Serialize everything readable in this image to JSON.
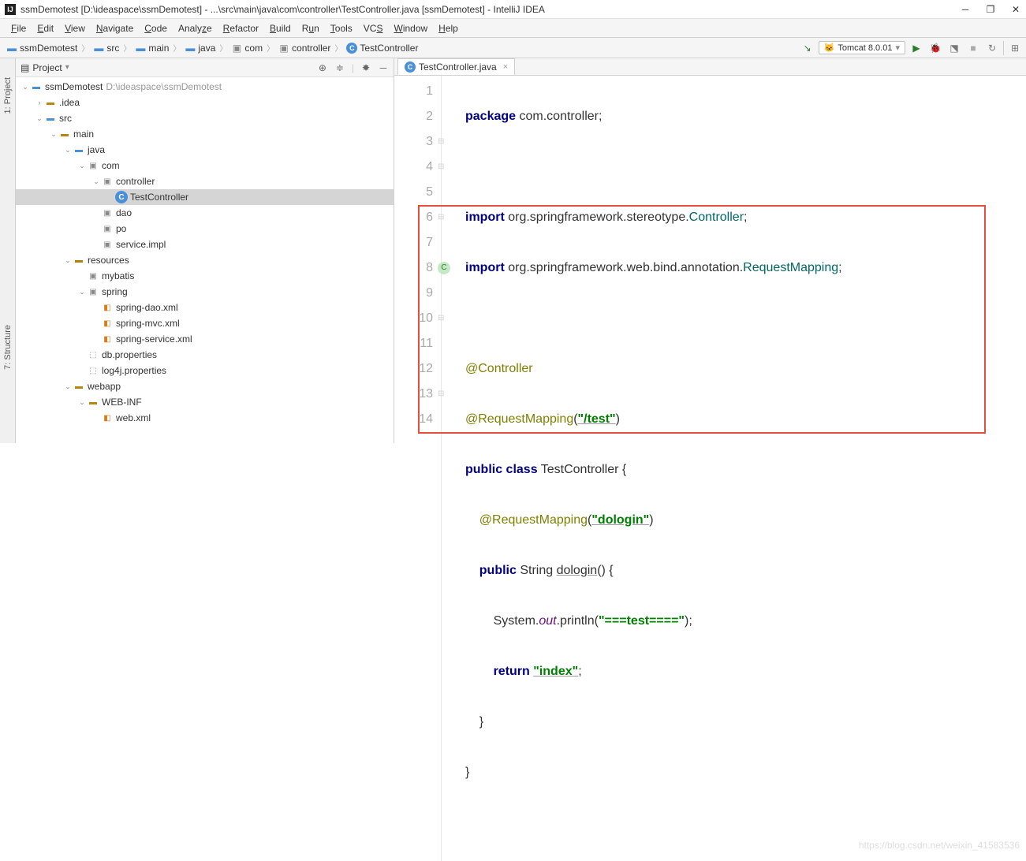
{
  "window": {
    "title": "ssmDemotest [D:\\ideaspace\\ssmDemotest] - ...\\src\\main\\java\\com\\controller\\TestController.java [ssmDemotest] - IntelliJ IDEA"
  },
  "menu": [
    "File",
    "Edit",
    "View",
    "Navigate",
    "Code",
    "Analyze",
    "Refactor",
    "Build",
    "Run",
    "Tools",
    "VCS",
    "Window",
    "Help"
  ],
  "breadcrumb": [
    {
      "label": "ssmDemotest",
      "icon": "folder-blue"
    },
    {
      "label": "src",
      "icon": "folder-blue"
    },
    {
      "label": "main",
      "icon": "folder-blue"
    },
    {
      "label": "java",
      "icon": "folder-blue"
    },
    {
      "label": "com",
      "icon": "pkg"
    },
    {
      "label": "controller",
      "icon": "pkg"
    },
    {
      "label": "TestController",
      "icon": "class"
    }
  ],
  "runconfig": "Tomcat 8.0.01",
  "sidepanels": {
    "project": "1: Project",
    "structure": "7: Structure"
  },
  "projectpanel": {
    "title": "Project"
  },
  "tree": [
    {
      "depth": 0,
      "arrow": "v",
      "icon": "folder-blue",
      "label": "ssmDemotest",
      "path": "D:\\ideaspace\\ssmDemotest"
    },
    {
      "depth": 1,
      "arrow": ">",
      "icon": "folder",
      "label": ".idea"
    },
    {
      "depth": 1,
      "arrow": "v",
      "icon": "folder-blue",
      "label": "src"
    },
    {
      "depth": 2,
      "arrow": "v",
      "icon": "folder",
      "label": "main"
    },
    {
      "depth": 3,
      "arrow": "v",
      "icon": "folder-blue",
      "label": "java"
    },
    {
      "depth": 4,
      "arrow": "v",
      "icon": "pkg",
      "label": "com"
    },
    {
      "depth": 5,
      "arrow": "v",
      "icon": "pkg",
      "label": "controller"
    },
    {
      "depth": 6,
      "arrow": "",
      "icon": "class",
      "label": "TestController",
      "sel": true
    },
    {
      "depth": 5,
      "arrow": "",
      "icon": "pkg",
      "label": "dao"
    },
    {
      "depth": 5,
      "arrow": "",
      "icon": "pkg",
      "label": "po"
    },
    {
      "depth": 5,
      "arrow": "",
      "icon": "pkg",
      "label": "service.impl"
    },
    {
      "depth": 3,
      "arrow": "v",
      "icon": "folder-res",
      "label": "resources"
    },
    {
      "depth": 4,
      "arrow": "",
      "icon": "pkg",
      "label": "mybatis"
    },
    {
      "depth": 4,
      "arrow": "v",
      "icon": "pkg",
      "label": "spring"
    },
    {
      "depth": 5,
      "arrow": "",
      "icon": "xml",
      "label": "spring-dao.xml"
    },
    {
      "depth": 5,
      "arrow": "",
      "icon": "xml",
      "label": "spring-mvc.xml"
    },
    {
      "depth": 5,
      "arrow": "",
      "icon": "xml",
      "label": "spring-service.xml"
    },
    {
      "depth": 4,
      "arrow": "",
      "icon": "prop",
      "label": "db.properties"
    },
    {
      "depth": 4,
      "arrow": "",
      "icon": "prop",
      "label": "log4j.properties"
    },
    {
      "depth": 3,
      "arrow": "v",
      "icon": "folder",
      "label": "webapp"
    },
    {
      "depth": 4,
      "arrow": "v",
      "icon": "folder",
      "label": "WEB-INF"
    },
    {
      "depth": 5,
      "arrow": "",
      "icon": "xml",
      "label": "web.xml"
    }
  ],
  "tabs": [
    {
      "label": "TestController.java"
    }
  ],
  "code": {
    "l1_pkg": "package",
    "l1_rest": " com.controller;",
    "l3_imp": "import",
    "l3_rest": " org.springframework.stereotype.",
    "l3_cls": "Controller",
    "l3_semi": ";",
    "l4_imp": "import",
    "l4_rest": " org.springframework.web.bind.annotation.",
    "l4_cls": "RequestMapping",
    "l4_semi": ";",
    "l6": "@Controller",
    "l7_ann": "@RequestMapping",
    "l7_open": "(",
    "l7_str": "\"/test\"",
    "l7_close": ")",
    "l8_pub": "public class",
    "l8_name": " TestController {",
    "l9_ann": "@RequestMapping",
    "l9_open": "(",
    "l9_str": "\"dologin\"",
    "l9_close": ")",
    "l10_pub": "public",
    "l10_rest": " String ",
    "l10_m": "dologin",
    "l10_p": "() {",
    "l11_sys": "System.",
    "l11_out": "out",
    "l11_pr": ".println(",
    "l11_str": "\"===test====\"",
    "l11_end": ");",
    "l12_ret": "return ",
    "l12_str": "\"index\"",
    "l12_semi": ";",
    "l13": "    }",
    "l14": "}"
  },
  "watermark": "https://blog.csdn.net/weixin_41583536"
}
